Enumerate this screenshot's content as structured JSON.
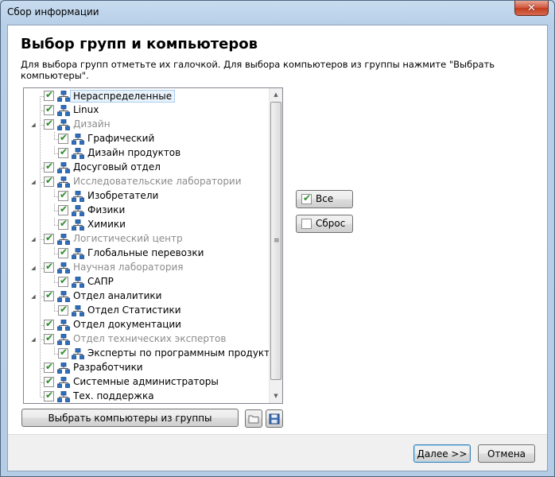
{
  "window": {
    "title": "Сбор информации",
    "close_glyph": "✕"
  },
  "header": {
    "heading": "Выбор групп и компьютеров",
    "instructions": "Для выбора групп отметьте их галочкой. Для выбора компьютеров из группы нажмите \"Выбрать компьютеры\"."
  },
  "tree": {
    "items": [
      {
        "label": "Нераспределенные",
        "level": 0,
        "checked": true,
        "grey": false,
        "selected": true,
        "expander": ""
      },
      {
        "label": "Linux",
        "level": 0,
        "checked": true,
        "grey": false,
        "selected": false,
        "expander": ""
      },
      {
        "label": "Дизайн",
        "level": 0,
        "checked": true,
        "grey": true,
        "selected": false,
        "expander": "◢"
      },
      {
        "label": "Графический",
        "level": 1,
        "checked": true,
        "grey": false,
        "selected": false,
        "expander": ""
      },
      {
        "label": "Дизайн продуктов",
        "level": 1,
        "checked": true,
        "grey": false,
        "selected": false,
        "expander": ""
      },
      {
        "label": "Досуговый отдел",
        "level": 0,
        "checked": true,
        "grey": false,
        "selected": false,
        "expander": ""
      },
      {
        "label": "Исследовательские лаборатории",
        "level": 0,
        "checked": true,
        "grey": true,
        "selected": false,
        "expander": "◢"
      },
      {
        "label": "Изобретатели",
        "level": 1,
        "checked": true,
        "grey": false,
        "selected": false,
        "expander": ""
      },
      {
        "label": "Физики",
        "level": 1,
        "checked": true,
        "grey": false,
        "selected": false,
        "expander": ""
      },
      {
        "label": "Химики",
        "level": 1,
        "checked": true,
        "grey": false,
        "selected": false,
        "expander": ""
      },
      {
        "label": "Логистический центр",
        "level": 0,
        "checked": true,
        "grey": true,
        "selected": false,
        "expander": "◢"
      },
      {
        "label": "Глобальные перевозки",
        "level": 1,
        "checked": true,
        "grey": false,
        "selected": false,
        "expander": ""
      },
      {
        "label": "Научная лаборатория",
        "level": 0,
        "checked": true,
        "grey": true,
        "selected": false,
        "expander": "◢"
      },
      {
        "label": "САПР",
        "level": 1,
        "checked": true,
        "grey": false,
        "selected": false,
        "expander": ""
      },
      {
        "label": "Отдел аналитики",
        "level": 0,
        "checked": true,
        "grey": false,
        "selected": false,
        "expander": "◢"
      },
      {
        "label": "Отдел Статистики",
        "level": 1,
        "checked": true,
        "grey": false,
        "selected": false,
        "expander": ""
      },
      {
        "label": "Отдел документации",
        "level": 0,
        "checked": true,
        "grey": false,
        "selected": false,
        "expander": ""
      },
      {
        "label": "Отдел технических экспертов",
        "level": 0,
        "checked": true,
        "grey": true,
        "selected": false,
        "expander": "◢"
      },
      {
        "label": "Эксперты по программным продуктам",
        "level": 1,
        "checked": true,
        "grey": false,
        "selected": false,
        "expander": ""
      },
      {
        "label": "Разработчики",
        "level": 0,
        "checked": true,
        "grey": false,
        "selected": false,
        "expander": ""
      },
      {
        "label": "Системные администраторы",
        "level": 0,
        "checked": true,
        "grey": false,
        "selected": false,
        "expander": ""
      },
      {
        "label": "Тех. поддержка",
        "level": 0,
        "checked": true,
        "grey": false,
        "selected": false,
        "expander": ""
      }
    ]
  },
  "buttons": {
    "select_computers": "Выбрать компьютеры из группы",
    "all": "Все",
    "all_checked": true,
    "reset": "Сброс",
    "reset_checked": false,
    "next": "Далее >>",
    "cancel": "Отмена"
  },
  "colors": {
    "check_green": "#2c8d2c",
    "grey_text": "#8c8c8c",
    "network_blue": "#2f6fc0"
  }
}
